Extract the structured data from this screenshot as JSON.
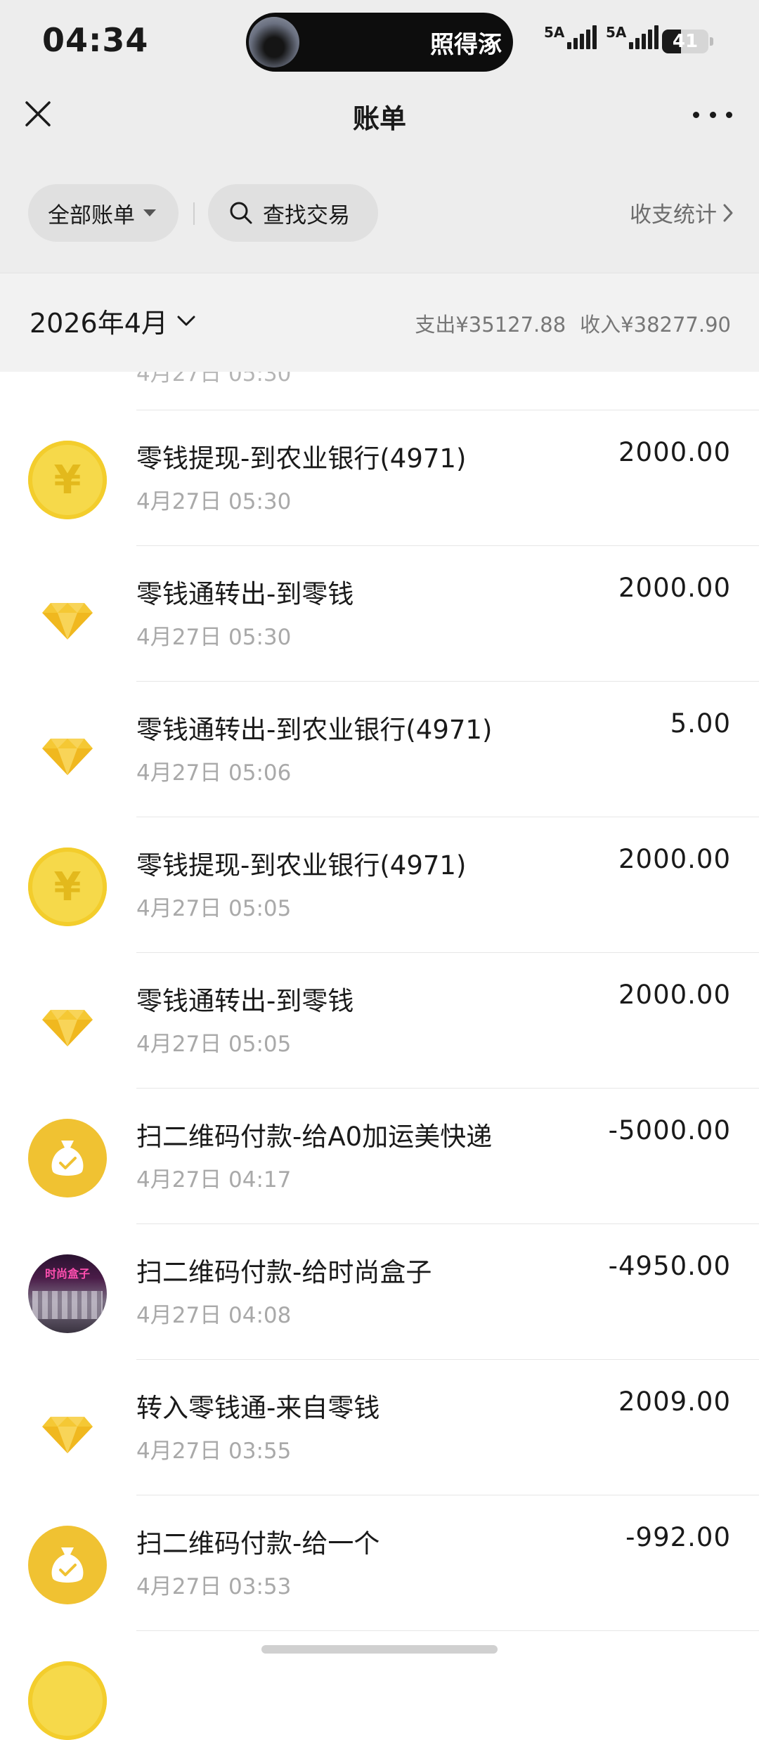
{
  "status_bar": {
    "time": "04:34",
    "island_text": "照得涿",
    "signal1_label": "5A",
    "signal2_label": "5A",
    "battery": "41",
    "battery_level": 0.41
  },
  "nav": {
    "title": "账单",
    "close_icon": "close-icon",
    "more_icon": "more-icon"
  },
  "filters": {
    "all_bills": "全部账单",
    "search": "查找交易",
    "stats": "收支统计"
  },
  "month_bar": {
    "month": "2026年4月",
    "expense": "支出¥35127.88",
    "income": "收入¥38277.90"
  },
  "partial_row_time": "4月27日 05:30",
  "transactions": [
    {
      "icon": "coin",
      "title": "零钱提现-到农业银行(4971)",
      "time": "4月27日 05:30",
      "amount": "2000.00"
    },
    {
      "icon": "diamond",
      "title": "零钱通转出-到零钱",
      "time": "4月27日 05:30",
      "amount": "2000.00"
    },
    {
      "icon": "diamond",
      "title": "零钱通转出-到农业银行(4971)",
      "time": "4月27日 05:06",
      "amount": "5.00"
    },
    {
      "icon": "coin",
      "title": "零钱提现-到农业银行(4971)",
      "time": "4月27日 05:05",
      "amount": "2000.00"
    },
    {
      "icon": "diamond",
      "title": "零钱通转出-到零钱",
      "time": "4月27日 05:05",
      "amount": "2000.00"
    },
    {
      "icon": "money-bag",
      "title": "扫二维码付款-给A0加运美快递",
      "time": "4月27日 04:17",
      "amount": "-5000.00"
    },
    {
      "icon": "photo",
      "title": "扫二维码付款-给时尚盒子",
      "time": "4月27日 04:08",
      "amount": "-4950.00"
    },
    {
      "icon": "diamond",
      "title": "转入零钱通-来自零钱",
      "time": "4月27日 03:55",
      "amount": "2009.00"
    },
    {
      "icon": "money-bag",
      "title": "扫二维码付款-给一个",
      "time": "4月27日 03:53",
      "amount": "-992.00"
    }
  ],
  "colors": {
    "header_bg": "#ededed",
    "coin_yellow": "#f6d94a",
    "diamond_gold": "#f2c12e",
    "muted_text": "#a9a9a9"
  }
}
